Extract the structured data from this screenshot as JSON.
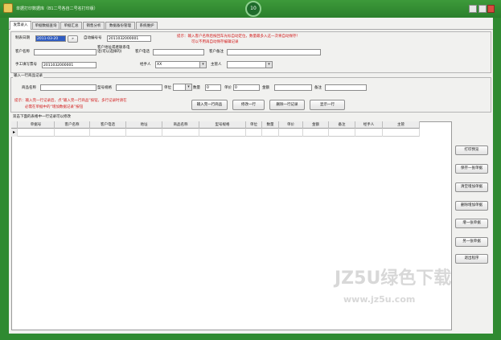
{
  "window": {
    "title": "单据打印数据库（B1二号各自二号名打印版）",
    "badge": "10"
  },
  "tabs": [
    "发票录入",
    "单据数据查询",
    "单据汇总",
    "销售分析",
    "数据备份管理",
    "系统维护"
  ],
  "header_form": {
    "date_label": "制表日期",
    "date_value": "2011-03-20",
    "auto_number_label": "自动编号号",
    "auto_number_value": "2011032000001",
    "notice_line1": "提示：输入客户名称后按回车光标自动定位，数量最多入这一次将自动保存！",
    "notice_line2": "可以不用再自动保存编辑记录",
    "customer_name_label": "客户名称",
    "customer_contact_label": "客户地址或者联系电话(可以选择的)",
    "customer_phone_label": "客户电话",
    "customer_note_label": "客户备注",
    "manual_number_label": "手工填写票号",
    "manual_number_value": "2011032000001",
    "handler_label": "经手人",
    "handler_value": "XX",
    "director_label": "主管人"
  },
  "detail_section": {
    "title": "输入一行商品记录",
    "product_name_label": "商品名称",
    "spec_label": "型号规格",
    "unit_label": "单位",
    "quantity_label": "数量",
    "quantity_value": "0",
    "price_label": "单价",
    "price_value": "0",
    "amount_label": "金额",
    "note_label": "备注",
    "hint_line1": "提示：输入完一行记录后，点“输入完一行商品”按钮，多行记录时请在",
    "hint_line2": "必需在单据中的“增加数据记录”按钮",
    "buttons": [
      "输入完一行商品",
      "修改一行",
      "删除一行记录",
      "显示一行"
    ]
  },
  "grid_section": {
    "title": "双击下面的表格中一行记录可以修改",
    "columns": [
      "单据号",
      "客户名称",
      "客户电话",
      "地址",
      "商品名称",
      "型号规格",
      "单位",
      "数量",
      "单价",
      "金额",
      "备注",
      "经手人",
      "主管"
    ],
    "row_marker": "▸"
  },
  "side_buttons": [
    "打印预览",
    "保存一张单据",
    "清空增加单据",
    "删除增加单据",
    "增一张单据",
    "另一张单据",
    "退出程序"
  ],
  "watermark": {
    "line1": "JZ5U绿色下载",
    "line2": "www.jz5u.com"
  },
  "colors": {
    "title_green": "#2b7f2c",
    "selection_blue": "#2f5cc2",
    "notice_red": "#d21a1a"
  }
}
